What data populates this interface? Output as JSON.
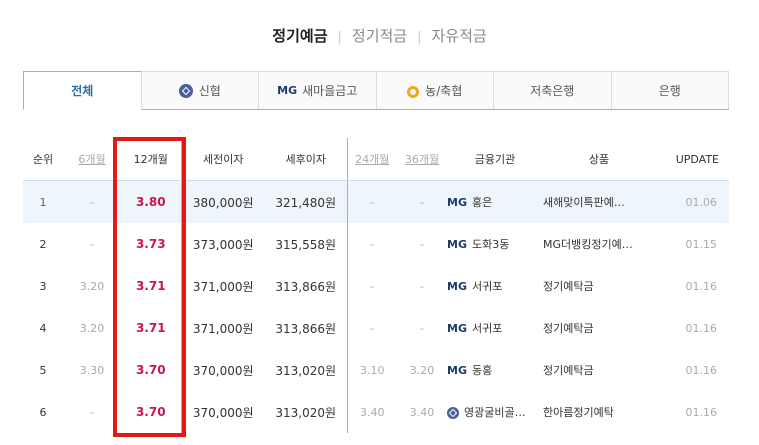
{
  "product_tabs": [
    {
      "label": "정기예금",
      "active": true
    },
    {
      "label": "정기적금",
      "active": false
    },
    {
      "label": "자유적금",
      "active": false
    }
  ],
  "separator": "|",
  "institution_tabs": [
    {
      "label": "전체",
      "icon": "",
      "active": true
    },
    {
      "label": "신협",
      "icon": "shinhyup-icon",
      "active": false
    },
    {
      "label": "새마을금고",
      "icon": "mg-icon",
      "prefix": "MG",
      "active": false
    },
    {
      "label": "농/축협",
      "icon": "nonghyup-icon",
      "active": false
    },
    {
      "label": "저축은행",
      "icon": "",
      "active": false
    },
    {
      "label": "은행",
      "icon": "",
      "active": false
    }
  ],
  "table": {
    "headers": [
      "순위",
      "6개월",
      "12개월",
      "세전이자",
      "세후이자",
      "24개월",
      "36개월",
      "금융기관",
      "상품",
      "UPDATE"
    ],
    "rows": [
      {
        "rank": "1",
        "m6": "-",
        "m12": "3.80",
        "pre_tax": "380,000원",
        "post_tax": "321,480원",
        "m24": "-",
        "m36": "-",
        "inst_prefix": "MG",
        "institution": "홍은",
        "product": "새해맞이특판예…",
        "update": "01.06",
        "highlight": true
      },
      {
        "rank": "2",
        "m6": "-",
        "m12": "3.73",
        "pre_tax": "373,000원",
        "post_tax": "315,558원",
        "m24": "-",
        "m36": "-",
        "inst_prefix": "MG",
        "institution": "도화3동",
        "product": "MG더뱅킹정기예…",
        "update": "01.15"
      },
      {
        "rank": "3",
        "m6": "3.20",
        "m12": "3.71",
        "pre_tax": "371,000원",
        "post_tax": "313,866원",
        "m24": "-",
        "m36": "-",
        "inst_prefix": "MG",
        "institution": "서귀포",
        "product": "정기예탁금",
        "update": "01.16"
      },
      {
        "rank": "4",
        "m6": "3.20",
        "m12": "3.71",
        "pre_tax": "371,000원",
        "post_tax": "313,866원",
        "m24": "-",
        "m36": "-",
        "inst_prefix": "MG",
        "institution": "서귀포",
        "product": "정기예탁금",
        "update": "01.16"
      },
      {
        "rank": "5",
        "m6": "3.30",
        "m12": "3.70",
        "pre_tax": "370,000원",
        "post_tax": "313,020원",
        "m24": "3.10",
        "m36": "3.20",
        "inst_prefix": "MG",
        "institution": "동홍",
        "product": "정기예탁금",
        "update": "01.16"
      },
      {
        "rank": "6",
        "m6": "-",
        "m12": "3.70",
        "pre_tax": "370,000원",
        "post_tax": "313,020원",
        "m24": "3.40",
        "m36": "3.40",
        "inst_prefix": "",
        "institution": "영광굴비골…",
        "product": "한아름정기예탁",
        "update": "01.16"
      }
    ]
  },
  "colors": {
    "rate": "#c8184c",
    "accent": "#2b6ea8",
    "highlight_box": "#e41818"
  }
}
